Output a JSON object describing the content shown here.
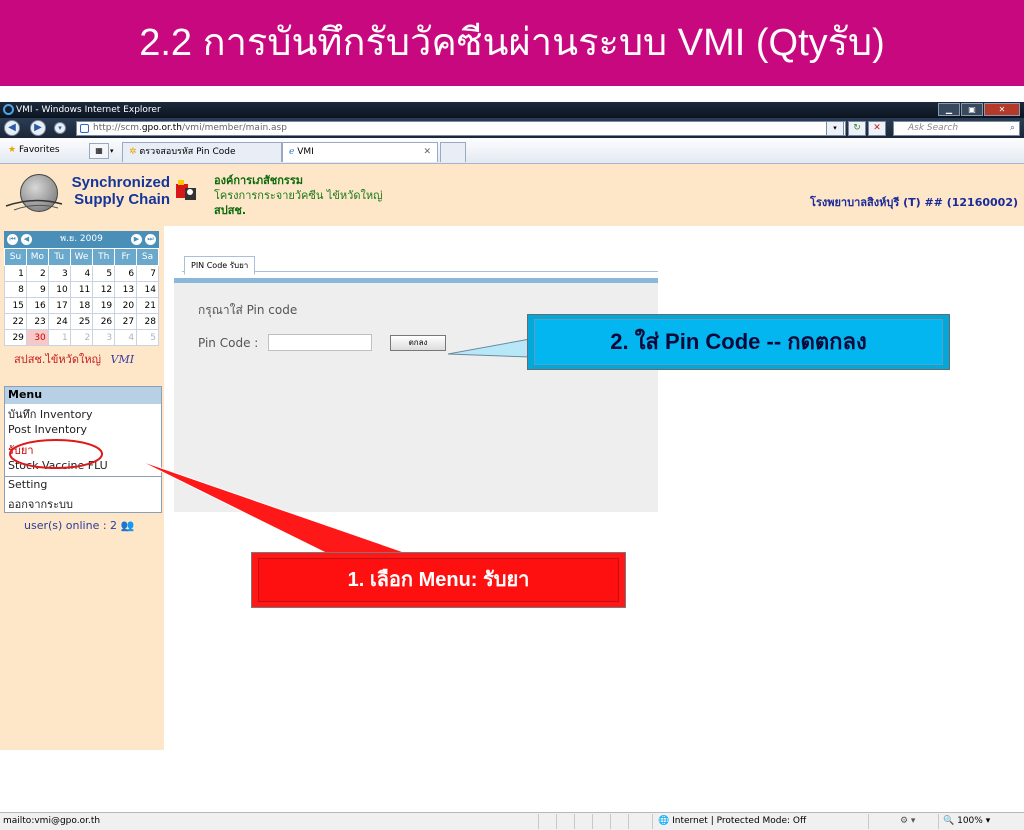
{
  "slide": {
    "title": "2.2 การบันทึกรับวัคซีนผ่านระบบ VMI (Qtyรับ)"
  },
  "browser": {
    "window_title": "VMI - Windows Internet Explorer",
    "address_prefix": "http://scm.",
    "address_domain": "gpo.or.th",
    "address_path": "/vmi/member/main.asp",
    "search_placeholder": "Ask Search",
    "favorites_label": "Favorites",
    "tabs": [
      {
        "label": "ตรวจสอบรหัส Pin Code"
      },
      {
        "label": "VMI"
      }
    ]
  },
  "header": {
    "logo_line1": "Synchronized",
    "logo_line2": "Supply Chain",
    "org_line1": "องค์การเภสัชกรรม",
    "org_line2": "โครงการกระจายวัคซีน ไข้หวัดใหญ่",
    "org_line3": "สปสช.",
    "hospital": "โรงพยาบาลสิงห์บุรี (T) ## (12160002)"
  },
  "calendar": {
    "month_label": "พ.ย. 2009",
    "weekdays": [
      "Su",
      "Mo",
      "Tu",
      "We",
      "Th",
      "Fr",
      "Sa"
    ],
    "weeks": [
      [
        "1",
        "2",
        "3",
        "4",
        "5",
        "6",
        "7"
      ],
      [
        "8",
        "9",
        "10",
        "11",
        "12",
        "13",
        "14"
      ],
      [
        "15",
        "16",
        "17",
        "18",
        "19",
        "20",
        "21"
      ],
      [
        "22",
        "23",
        "24",
        "25",
        "26",
        "27",
        "28"
      ],
      [
        "29",
        "30",
        "1",
        "2",
        "3",
        "4",
        "5"
      ]
    ],
    "footer": "สปสช.ไข้หวัดใหญ่",
    "footer_logo": "VMI"
  },
  "menu": {
    "title": "Menu",
    "items": [
      "บันทึก Inventory",
      "Post Inventory",
      "รับยา",
      "Stock Vaccine FLU",
      "Setting",
      "ออกจากระบบ"
    ]
  },
  "online": "user(s) online : 2",
  "pin": {
    "tab_label": "PIN Code รับยา",
    "prompt": "กรุณาใส่ Pin code",
    "label": "Pin Code :",
    "input_value": "",
    "ok_label": "ตกลง"
  },
  "callouts": {
    "step1": "1. เลือก Menu: รับยา",
    "step2": "2. ใส่ Pin Code -- กดตกลง"
  },
  "status": {
    "link": "mailto:vmi@gpo.or.th",
    "zone": "Internet | Protected Mode: Off",
    "zoom": "100%"
  }
}
